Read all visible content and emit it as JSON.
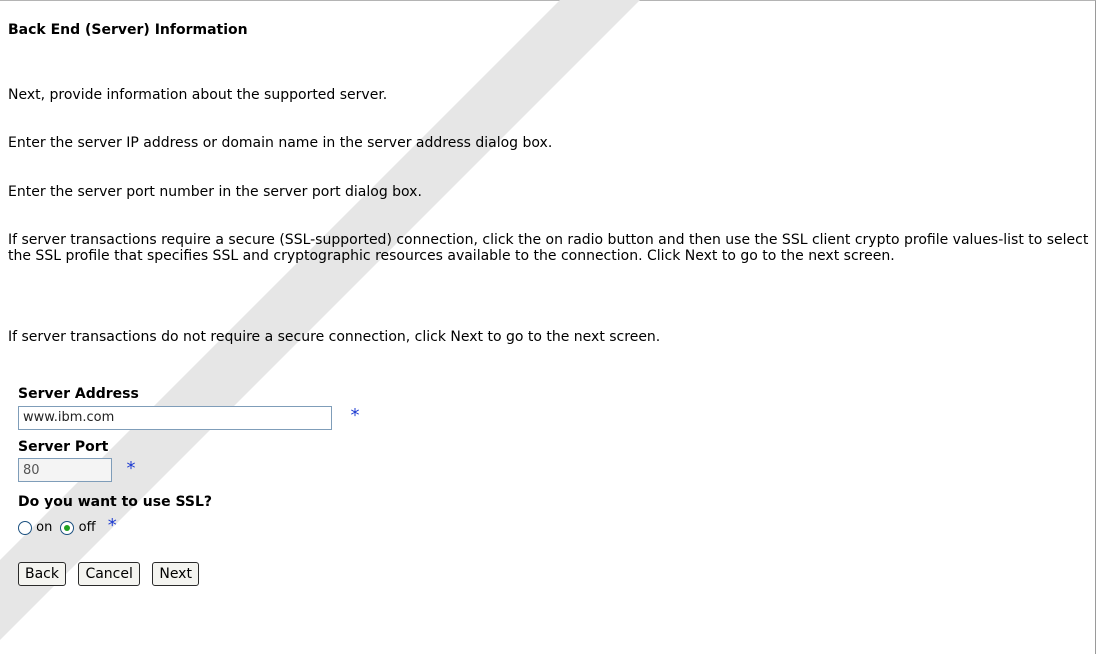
{
  "page": {
    "title": "Back End (Server) Information",
    "paragraphs": [
      "Next, provide information about the supported server.",
      "Enter the server IP address or domain name in the server address dialog box.",
      "Enter the server port number in the server port dialog box.",
      "If server transactions require a secure (SSL-supported) connection, click the on radio button and then use the SSL client crypto profile values-list to select the SSL profile that specifies SSL and cryptographic resources available to the connection. Click Next to go to the next screen.",
      "If server transactions do not require a secure connection, click Next to go to the next screen."
    ]
  },
  "form": {
    "server_address": {
      "label": "Server Address",
      "value": "www.ibm.com"
    },
    "server_port": {
      "label": "Server Port",
      "value": "80"
    },
    "ssl": {
      "label": "Do you want to use SSL?",
      "on_label": "on",
      "off_label": "off",
      "selected": "off"
    },
    "required_marker": "*"
  },
  "buttons": {
    "back": "Back",
    "cancel": "Cancel",
    "next": "Next"
  },
  "colors": {
    "required": "#1d3bd1",
    "radio_selected": "#21a121"
  }
}
